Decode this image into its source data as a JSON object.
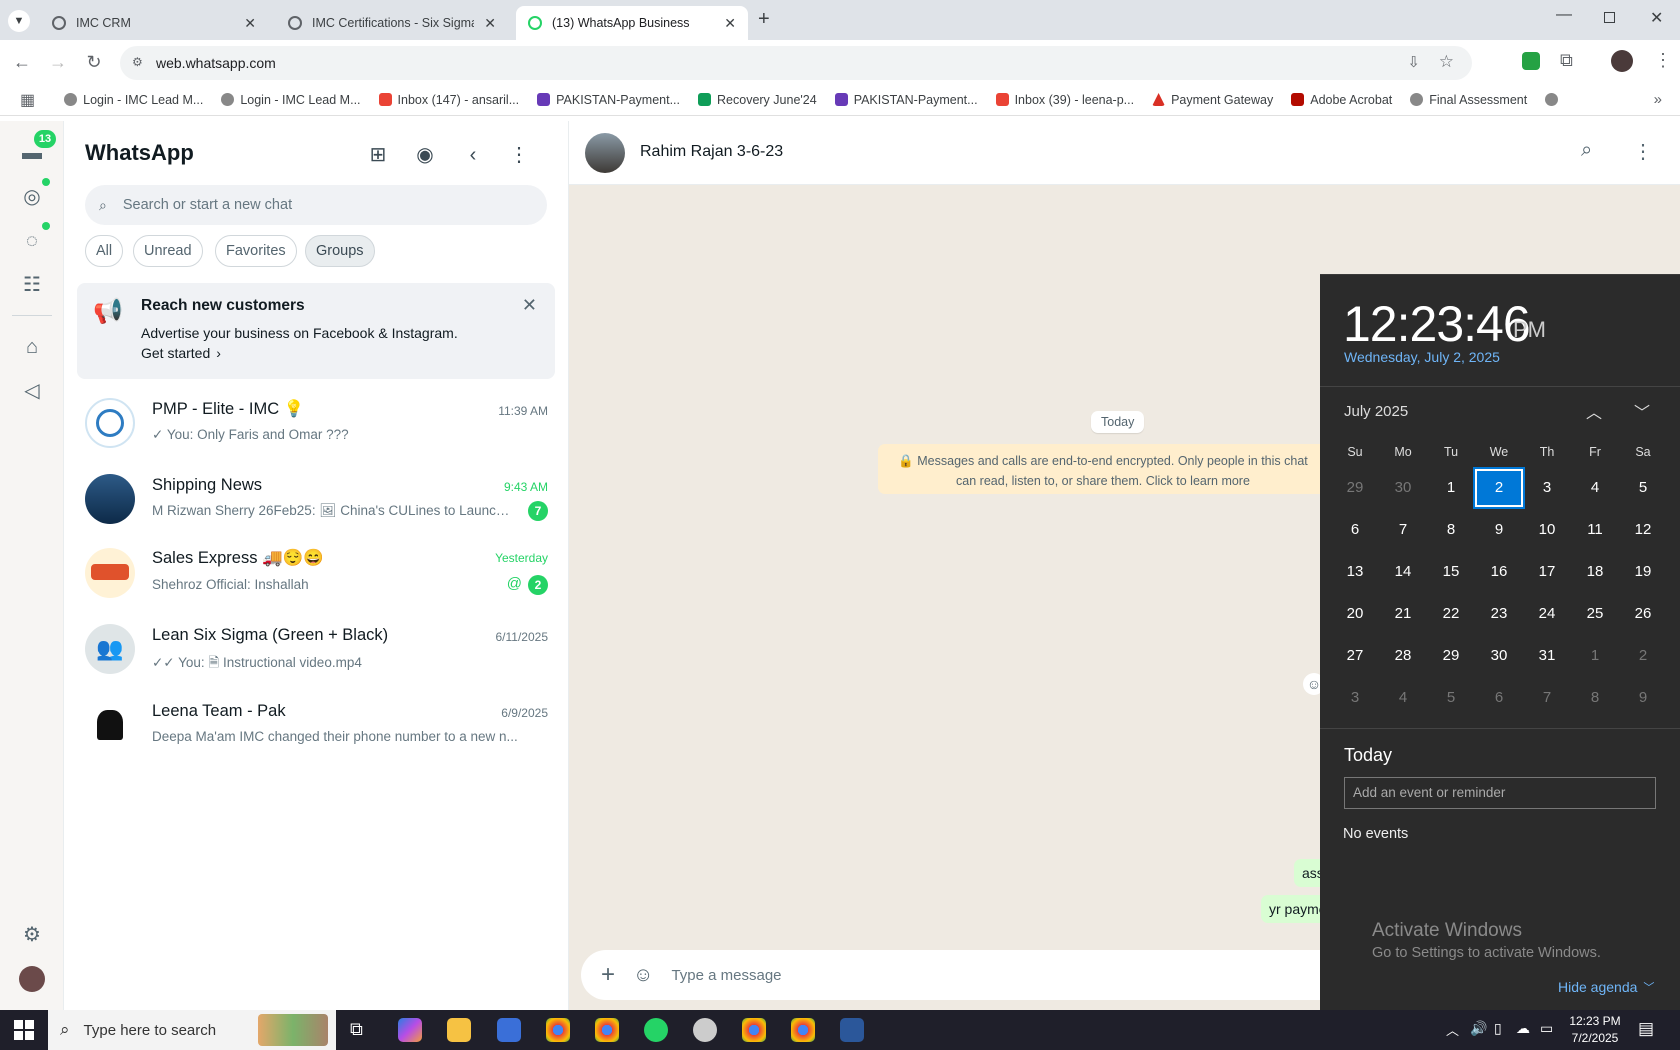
{
  "browser": {
    "tabs": [
      {
        "title": "IMC CRM"
      },
      {
        "title": "IMC Certifications - Six Sigma G"
      },
      {
        "title": "(13) WhatsApp Business"
      }
    ],
    "url": "web.whatsapp.com",
    "bookmarks": [
      {
        "label": "Login - IMC Lead M...",
        "icon": "bookmark-icon"
      },
      {
        "label": "Login - IMC Lead M...",
        "icon": "bookmark-icon"
      },
      {
        "label": "Inbox (147) - ansaril...",
        "icon": "gmail-icon"
      },
      {
        "label": "PAKISTAN-Payment...",
        "icon": "form-icon"
      },
      {
        "label": "Recovery June'24",
        "icon": "sheet-icon"
      },
      {
        "label": "PAKISTAN-Payment...",
        "icon": "form-icon"
      },
      {
        "label": "Inbox (39) - leena-p...",
        "icon": "gmail-icon"
      },
      {
        "label": "Payment Gateway",
        "icon": "bookmark-icon"
      },
      {
        "label": "Adobe Acrobat",
        "icon": "acrobat-icon"
      },
      {
        "label": "Final Assessment",
        "icon": "bookmark-icon"
      }
    ]
  },
  "whatsapp": {
    "unread_badge": "13",
    "title": "WhatsApp",
    "search_placeholder": "Search or start a new chat",
    "filters": [
      "All",
      "Unread",
      "Favorites",
      "Groups"
    ],
    "selected_filter": "Groups",
    "promo": {
      "title": "Reach new customers",
      "body": "Advertise your business on Facebook & Instagram.",
      "cta": "Get started"
    },
    "chats": [
      {
        "name": "PMP - Elite - IMC 💡",
        "time": "11:39 AM",
        "preview": "✓ You: Only Faris and Omar ???",
        "badge": ""
      },
      {
        "name": "Shipping News",
        "time": "9:43 AM",
        "preview": "M Rizwan Sherry 26Feb25: 🖼 China's CULines to Launch ...",
        "badge": "7"
      },
      {
        "name": "Sales Express 🚚😌😄",
        "time": "Yesterday",
        "preview": "Shehroz Official: Inshallah",
        "badge": "2"
      },
      {
        "name": "Lean Six Sigma (Green + Black)",
        "time": "6/11/2025",
        "preview": "✓✓ You: 🗎 Instructional video.mp4",
        "badge": ""
      },
      {
        "name": "Leena Team - Pak",
        "time": "6/9/2025",
        "preview": "Deepa Ma'am IMC changed their phone number to a new n...",
        "badge": ""
      }
    ],
    "conversation": {
      "contact": "Rahim Rajan 3-6-23",
      "day_label": "Today",
      "encryption_notice": "🔒 Messages and calls are end-to-end encrypted. Only people in this chat can read, listen to, or share them. Click to learn more",
      "bubbles": [
        "ass",
        "yr payme"
      ],
      "composer_placeholder": "Type a message"
    }
  },
  "calendar": {
    "time": "12:23:46",
    "ampm": "PM",
    "date_long": "Wednesday, July 2, 2025",
    "month": "July 2025",
    "weekdays": [
      "Su",
      "Mo",
      "Tu",
      "We",
      "Th",
      "Fr",
      "Sa"
    ],
    "weeks": [
      [
        "29",
        "30",
        "1",
        "2",
        "3",
        "4",
        "5"
      ],
      [
        "6",
        "7",
        "8",
        "9",
        "10",
        "11",
        "12"
      ],
      [
        "13",
        "14",
        "15",
        "16",
        "17",
        "18",
        "19"
      ],
      [
        "20",
        "21",
        "22",
        "23",
        "24",
        "25",
        "26"
      ],
      [
        "27",
        "28",
        "29",
        "30",
        "31",
        "1",
        "2"
      ],
      [
        "3",
        "4",
        "5",
        "6",
        "7",
        "8",
        "9"
      ]
    ],
    "today": "2",
    "agenda_title": "Today",
    "agenda_placeholder": "Add an event or reminder",
    "no_events": "No events",
    "hide_agenda": "Hide agenda"
  },
  "watermark": {
    "line1": "Activate Windows",
    "line2": "Go to Settings to activate Windows."
  },
  "taskbar": {
    "search_placeholder": "Type here to search",
    "time": "12:23 PM",
    "date": "7/2/2025"
  }
}
